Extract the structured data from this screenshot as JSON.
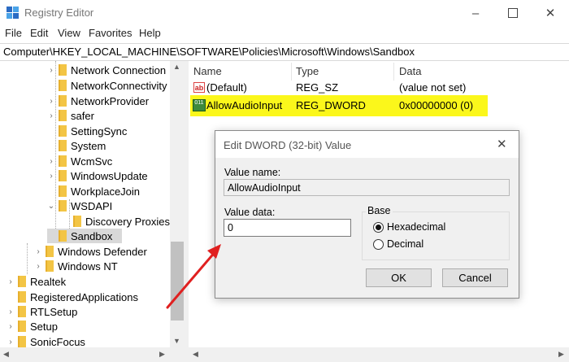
{
  "window": {
    "title": "Registry Editor"
  },
  "menu": [
    "File",
    "Edit",
    "View",
    "Favorites",
    "Help"
  ],
  "address": "Computer\\HKEY_LOCAL_MACHINE\\SOFTWARE\\Policies\\Microsoft\\Windows\\Sandbox",
  "tree": {
    "items": [
      {
        "label": "Network Connection",
        "chevron": "›",
        "sel": false
      },
      {
        "label": "NetworkConnectivity",
        "chevron": "",
        "sel": false
      },
      {
        "label": "NetworkProvider",
        "chevron": "›",
        "sel": false
      },
      {
        "label": "safer",
        "chevron": "›",
        "sel": false
      },
      {
        "label": "SettingSync",
        "chevron": "",
        "sel": false
      },
      {
        "label": "System",
        "chevron": "",
        "sel": false
      },
      {
        "label": "WcmSvc",
        "chevron": "›",
        "sel": false
      },
      {
        "label": "WindowsUpdate",
        "chevron": "›",
        "sel": false
      },
      {
        "label": "WorkplaceJoin",
        "chevron": "",
        "sel": false
      },
      {
        "label": "WSDAPI",
        "chevron": "⌄",
        "sel": false
      },
      {
        "label": "Discovery Proxies",
        "chevron": "",
        "sel": false
      },
      {
        "label": "Sandbox",
        "chevron": "",
        "sel": true
      },
      {
        "label": "Windows Defender",
        "chevron": "›",
        "sel": false
      },
      {
        "label": "Windows NT",
        "chevron": "›",
        "sel": false
      },
      {
        "label": "Realtek",
        "chevron": "›",
        "sel": false
      },
      {
        "label": "RegisteredApplications",
        "chevron": "",
        "sel": false
      },
      {
        "label": "RTLSetup",
        "chevron": "›",
        "sel": false
      },
      {
        "label": "Setup",
        "chevron": "›",
        "sel": false
      },
      {
        "label": "SonicFocus",
        "chevron": "›",
        "sel": false
      }
    ]
  },
  "list": {
    "headers": {
      "name": "Name",
      "type": "Type",
      "data": "Data"
    },
    "rows": [
      {
        "name": "(Default)",
        "type": "REG_SZ",
        "data": "(value not set)",
        "icon": "ab"
      },
      {
        "name": "AllowAudioInput",
        "type": "REG_DWORD",
        "data": "0x00000000 (0)",
        "icon": "011"
      }
    ],
    "highlight_color": "#fbf71b"
  },
  "dialog": {
    "title": "Edit DWORD (32-bit) Value",
    "value_name_label": "Value name:",
    "value_name": "AllowAudioInput",
    "value_data_label": "Value data:",
    "value_data": "0",
    "base_label": "Base",
    "hex_label": "Hexadecimal",
    "dec_label": "Decimal",
    "base_selected": "Hexadecimal",
    "ok_label": "OK",
    "cancel_label": "Cancel"
  },
  "annotation": {
    "arrow_color": "#e02020"
  }
}
